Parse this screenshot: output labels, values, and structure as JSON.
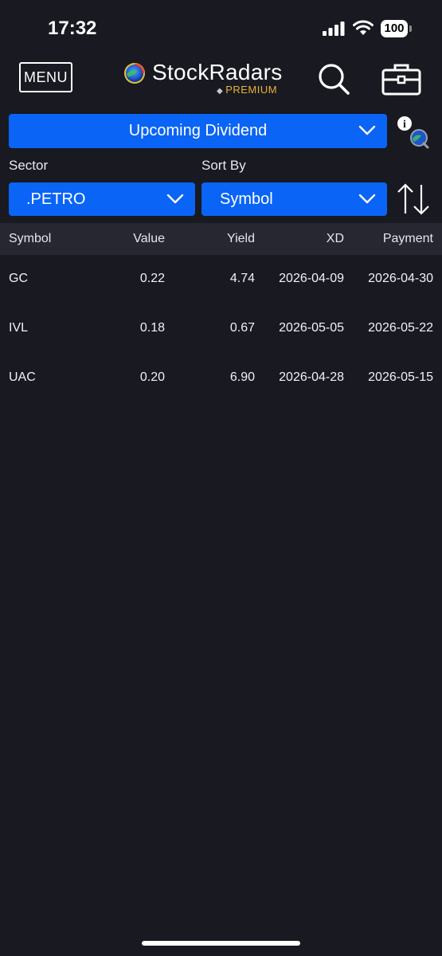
{
  "status_bar": {
    "time": "17:32",
    "battery": "100",
    "icons": [
      "signal-icon",
      "wifi-icon",
      "battery-icon"
    ]
  },
  "header": {
    "menu_label": "MENU",
    "app_name": "StockRadars",
    "tier": "PREMIUM",
    "icons": [
      "logo-icon",
      "search-icon",
      "briefcase-icon"
    ]
  },
  "view_select": {
    "selected": "Upcoming Dividend"
  },
  "filters": {
    "sector_label": "Sector",
    "sector_value": ".PETRO",
    "sort_label": "Sort By",
    "sort_value": "Symbol"
  },
  "table": {
    "columns": [
      "Symbol",
      "Value",
      "Yield",
      "XD",
      "Payment"
    ],
    "rows": [
      [
        "GC",
        "0.22",
        "4.74",
        "2026-04-09",
        "2026-04-30"
      ],
      [
        "IVL",
        "0.18",
        "0.67",
        "2026-05-05",
        "2026-05-22"
      ],
      [
        "UAC",
        "0.20",
        "6.90",
        "2026-04-28",
        "2026-05-15"
      ]
    ]
  },
  "colors": {
    "background": "#181921",
    "accent": "#0a64f5",
    "header_row": "#262731",
    "premium": "#e9b23a"
  }
}
